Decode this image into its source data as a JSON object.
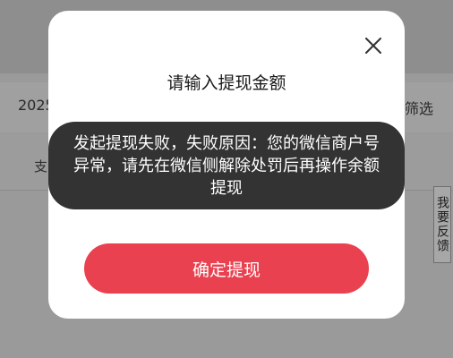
{
  "background": {
    "date_text": "2025",
    "filter_text": "筛选",
    "tab_text": "支",
    "feedback_label": "我要反馈"
  },
  "dialog": {
    "title": "请输入提现金额",
    "close_icon": "close-icon",
    "confirm_label": "确定提现"
  },
  "toast": {
    "message": "发起提现失败，失败原因：您的微信商户号异常，请先在微信侧解除处罚后再操作余额提现"
  },
  "colors": {
    "accent": "#ea4150",
    "toast_bg": "#282828",
    "dialog_bg": "#ffffff"
  }
}
